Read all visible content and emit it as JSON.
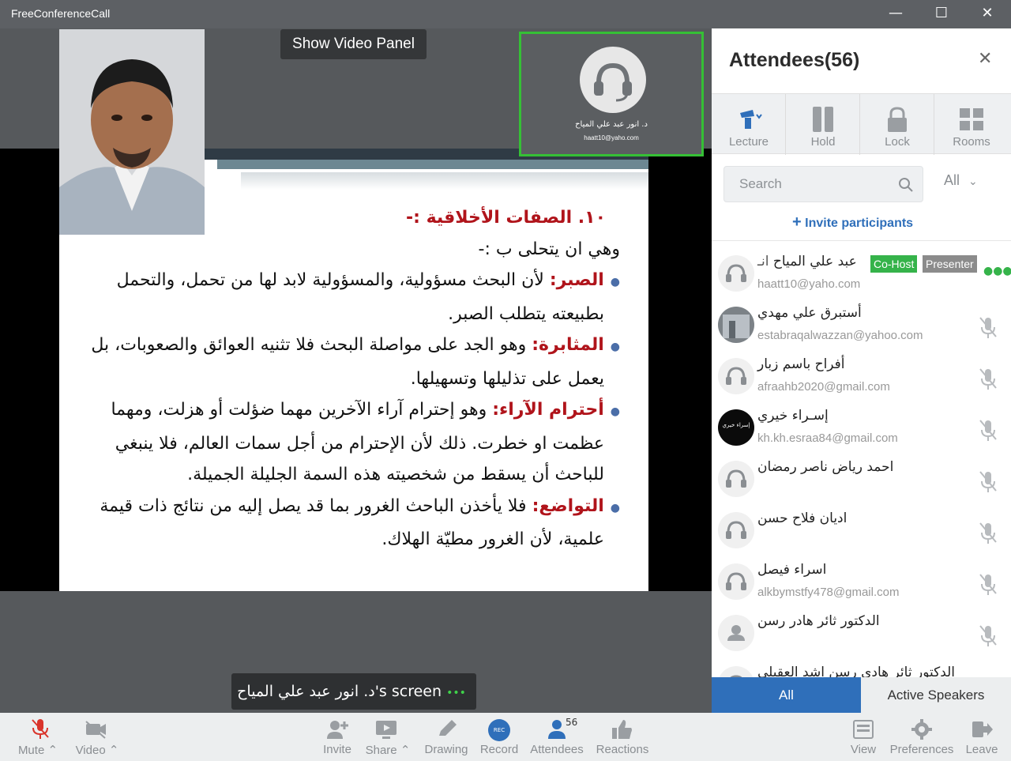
{
  "window": {
    "title": "FreeConferenceCall",
    "minimize": "—",
    "maximize": "☐",
    "close": "✕"
  },
  "stage": {
    "show_video_panel": "Show Video Panel",
    "speaker_tile": {
      "name": "د. انور عبد علي المياح",
      "email": "haatt10@yaho.com"
    },
    "screen_label": {
      "text": "د. انور عبد علي المياح's screen",
      "dots": "•••"
    },
    "slide": {
      "heading": "١٠. الصفات الأخلاقية :-",
      "intro": "وهي ان يتحلى ب :-",
      "bullets": [
        {
          "term": "الصبر:",
          "text": "لأن البحث مسؤولية، والمسؤولية لابد لها من تحمل، والتحمل",
          "cont": "بطبيعته يتطلب الصبر."
        },
        {
          "term": "المثابرة:",
          "text": "وهو الجد على مواصلة البحث فلا تثنيه العوائق والصعوبات، بل",
          "cont": "يعمل على تذليلها وتسهيلها."
        },
        {
          "term": "أحترام الآراء:",
          "text": "وهو إحترام آراء الآخرين مهما ضؤلت أو هزلت، ومهما",
          "cont": "عظمت او خطرت. ذلك لأن الإحترام من أجل سمات العالم، فلا ينبغي",
          "cont2": "للباحث أن يسقط من شخصيته هذه السمة الجليلة الجميلة."
        },
        {
          "term": "التواضع:",
          "text": "فلا يأخذن الباحث الغرور بما قد يصل إليه من نتائج ذات قيمة",
          "cont": "علمية، لأن الغرور مطيّة الهلاك."
        }
      ]
    }
  },
  "panel": {
    "title": "Attendees(56)",
    "close": "✕",
    "tools": [
      {
        "label": "Lecture",
        "icon": "lecture-icon"
      },
      {
        "label": "Hold",
        "icon": "pause-icon"
      },
      {
        "label": "Lock",
        "icon": "lock-icon"
      },
      {
        "label": "Rooms",
        "icon": "rooms-icon"
      }
    ],
    "search_placeholder": "Search",
    "filter": "All",
    "invite": "Invite participants",
    "attendees": [
      {
        "name": "عبد علي المياح",
        "prefix": "انـ",
        "email": "haatt10@yaho.com",
        "badges": [
          "Co-Host",
          "Presenter"
        ],
        "avatar": "headset"
      },
      {
        "name": "أستبرق علي مهدي",
        "email": "estabraqalwazzan@yahoo.com",
        "avatar": "photo"
      },
      {
        "name": "أفراح باسم زبار",
        "email": "afraahb2020@gmail.com",
        "avatar": "headset"
      },
      {
        "name": "إسـراء خيري",
        "email": "kh.kh.esraa84@gmail.com",
        "avatar": "dark",
        "avatar_text": "إسراء خيري"
      },
      {
        "name": "احمد رياض ناصر رمضان",
        "email": "",
        "avatar": "headset"
      },
      {
        "name": "اديان فلاح حسن",
        "email": "",
        "avatar": "headset"
      },
      {
        "name": "اسراء فيصل",
        "email": "alkbymstfy478@gmail.com",
        "avatar": "headset"
      },
      {
        "name": "الدكتور ثائر هادر رسن",
        "email": "",
        "avatar": "person"
      },
      {
        "name": "الدكتور ثائر هادي رسن اشد العقيلي",
        "email": "",
        "avatar": "headset"
      }
    ],
    "tabs": {
      "all": "All",
      "active": "Active Speakers"
    }
  },
  "toolbar": {
    "mute": "Mute",
    "video": "Video",
    "invite": "Invite",
    "share": "Share",
    "drawing": "Drawing",
    "record": "Record",
    "record_badge": "REC",
    "attendees": "Attendees",
    "attendees_count": "56",
    "reactions": "Reactions",
    "view": "View",
    "preferences": "Preferences",
    "leave": "Leave"
  },
  "colors": {
    "accent": "#2f6fba",
    "cohost": "#35b34a",
    "presenter": "#8b8b8b",
    "mute_red": "#d9342b",
    "slide_red": "#b0141b"
  }
}
